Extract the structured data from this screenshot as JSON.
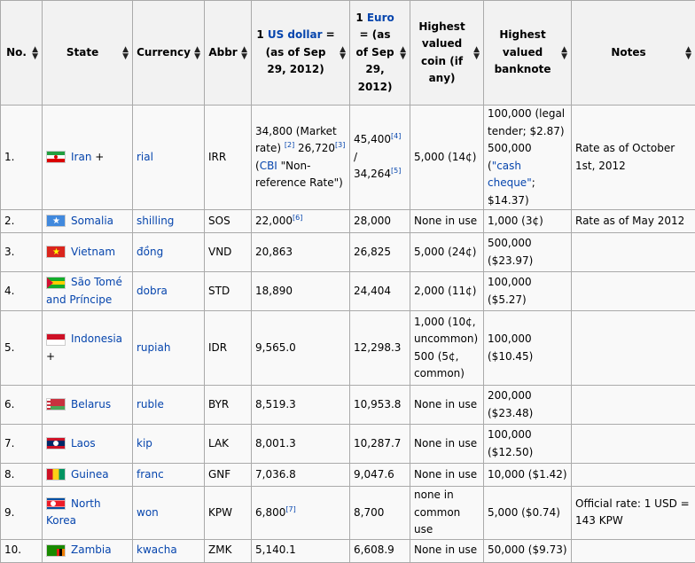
{
  "headers": [
    {
      "parts": [
        {
          "t": "No."
        }
      ]
    },
    {
      "parts": [
        {
          "t": "State"
        }
      ]
    },
    {
      "parts": [
        {
          "t": "Currency"
        }
      ]
    },
    {
      "parts": [
        {
          "t": "Abbr"
        }
      ]
    },
    {
      "parts": [
        {
          "t": "1 "
        },
        {
          "t": "US dollar",
          "link": true
        },
        {
          "t": " = (as of Sep 29, 2012)"
        }
      ]
    },
    {
      "parts": [
        {
          "t": "1 "
        },
        {
          "t": "Euro",
          "link": true
        },
        {
          "t": " = (as of Sep 29, 2012)"
        }
      ]
    },
    {
      "parts": [
        {
          "t": "Highest valued coin (if any)"
        }
      ]
    },
    {
      "parts": [
        {
          "t": "Highest valued banknote"
        }
      ]
    },
    {
      "parts": [
        {
          "t": "Notes"
        }
      ]
    }
  ],
  "icons": {
    "sort": "sort-arrows-icon"
  },
  "rows": [
    {
      "no": "1.",
      "flag": "iran-flag-icon",
      "flag_class": "flag-iran",
      "state": "Iran",
      "state_suffix": " +",
      "currency": "rial",
      "abbr": "IRR",
      "usd": [
        {
          "t": "34,800 (Market rate) "
        },
        {
          "t": "[2]",
          "sup": true,
          "link": true
        },
        {
          "t": " 26,720"
        },
        {
          "t": "[3]",
          "sup": true,
          "link": true
        },
        {
          "t": " (",
          "link": false
        },
        {
          "t": "CBI",
          "link": true
        },
        {
          "t": " \"Non-reference Rate\")"
        }
      ],
      "eur": [
        {
          "t": "45,400"
        },
        {
          "t": "[4]",
          "sup": true,
          "link": true
        },
        {
          "t": " / 34,264"
        },
        {
          "t": "[5]",
          "sup": true,
          "link": true
        }
      ],
      "coin": [
        {
          "t": "5,000 (14¢)"
        }
      ],
      "note": [
        {
          "t": "100,000 (legal tender; $2.87) 500,000 ("
        },
        {
          "t": "\"cash cheque\"",
          "link": true
        },
        {
          "t": "; $14.37)"
        }
      ],
      "notes": "Rate as of October 1st, 2012"
    },
    {
      "no": "2.",
      "flag": "somalia-flag-icon",
      "flag_class": "flag-somalia",
      "state": "Somalia",
      "state_suffix": "",
      "currency": "shilling",
      "abbr": "SOS",
      "usd": [
        {
          "t": "22,000"
        },
        {
          "t": "[6]",
          "sup": true,
          "link": true
        }
      ],
      "eur": [
        {
          "t": "28,000"
        }
      ],
      "coin": [
        {
          "t": "None in use"
        }
      ],
      "note": [
        {
          "t": "1,000 (3¢)"
        }
      ],
      "notes": "Rate as of May 2012"
    },
    {
      "no": "3.",
      "flag": "vietnam-flag-icon",
      "flag_class": "flag-vietnam",
      "state": "Vietnam",
      "state_suffix": "",
      "currency": "đồng",
      "abbr": "VND",
      "usd": [
        {
          "t": "20,863"
        }
      ],
      "eur": [
        {
          "t": "26,825"
        }
      ],
      "coin": [
        {
          "t": "5,000 (24¢)"
        }
      ],
      "note": [
        {
          "t": "500,000 ($23.97)"
        }
      ],
      "notes": ""
    },
    {
      "no": "4.",
      "flag": "sao-tome-flag-icon",
      "flag_class": "flag-stp",
      "state": "São Tomé and Príncipe",
      "state_suffix": "",
      "currency": "dobra",
      "abbr": "STD",
      "usd": [
        {
          "t": "18,890"
        }
      ],
      "eur": [
        {
          "t": "24,404"
        }
      ],
      "coin": [
        {
          "t": "2,000 (11¢)"
        }
      ],
      "note": [
        {
          "t": "100,000 ($5.27)"
        }
      ],
      "notes": ""
    },
    {
      "no": "5.",
      "flag": "indonesia-flag-icon",
      "flag_class": "flag-indonesia",
      "state": "Indonesia",
      "state_suffix": " +",
      "currency": "rupiah",
      "abbr": "IDR",
      "usd": [
        {
          "t": "9,565.0"
        }
      ],
      "eur": [
        {
          "t": "12,298.3"
        }
      ],
      "coin": [
        {
          "t": "1,000 (10¢, uncommon) 500 (5¢, common)"
        }
      ],
      "note": [
        {
          "t": "100,000 ($10.45)"
        }
      ],
      "notes": ""
    },
    {
      "no": "6.",
      "flag": "belarus-flag-icon",
      "flag_class": "flag-belarus",
      "state": "Belarus",
      "state_suffix": "",
      "currency": "ruble",
      "abbr": "BYR",
      "usd": [
        {
          "t": "8,519.3"
        }
      ],
      "eur": [
        {
          "t": "10,953.8"
        }
      ],
      "coin": [
        {
          "t": "None in use"
        }
      ],
      "note": [
        {
          "t": "200,000 ($23.48)"
        }
      ],
      "notes": ""
    },
    {
      "no": "7.",
      "flag": "laos-flag-icon",
      "flag_class": "flag-laos",
      "state": "Laos",
      "state_suffix": "",
      "currency": "kip",
      "abbr": "LAK",
      "usd": [
        {
          "t": "8,001.3"
        }
      ],
      "eur": [
        {
          "t": "10,287.7"
        }
      ],
      "coin": [
        {
          "t": "None in use"
        }
      ],
      "note": [
        {
          "t": "100,000 ($12.50)"
        }
      ],
      "notes": ""
    },
    {
      "no": "8.",
      "flag": "guinea-flag-icon",
      "flag_class": "flag-guinea",
      "state": "Guinea",
      "state_suffix": "",
      "currency": "franc",
      "abbr": "GNF",
      "usd": [
        {
          "t": "7,036.8"
        }
      ],
      "eur": [
        {
          "t": "9,047.6"
        }
      ],
      "coin": [
        {
          "t": "None in use"
        }
      ],
      "note": [
        {
          "t": "10,000 ($1.42)"
        }
      ],
      "notes": ""
    },
    {
      "no": "9.",
      "flag": "north-korea-flag-icon",
      "flag_class": "flag-nkorea",
      "state": "North Korea",
      "state_suffix": "",
      "currency": "won",
      "abbr": "KPW",
      "usd": [
        {
          "t": "6,800"
        },
        {
          "t": "[7]",
          "sup": true,
          "link": true
        }
      ],
      "eur": [
        {
          "t": "8,700"
        }
      ],
      "coin": [
        {
          "t": "none in common use"
        }
      ],
      "note": [
        {
          "t": "5,000 ($0.74)"
        }
      ],
      "notes": "Official rate: 1 USD = 143 KPW"
    },
    {
      "no": "10.",
      "flag": "zambia-flag-icon",
      "flag_class": "flag-zambia",
      "state": "Zambia",
      "state_suffix": "",
      "currency": "kwacha",
      "abbr": "ZMK",
      "usd": [
        {
          "t": "5,140.1"
        }
      ],
      "eur": [
        {
          "t": "6,608.9"
        }
      ],
      "coin": [
        {
          "t": "None in use"
        }
      ],
      "note": [
        {
          "t": "50,000 ($9.73)"
        }
      ],
      "notes": ""
    }
  ]
}
